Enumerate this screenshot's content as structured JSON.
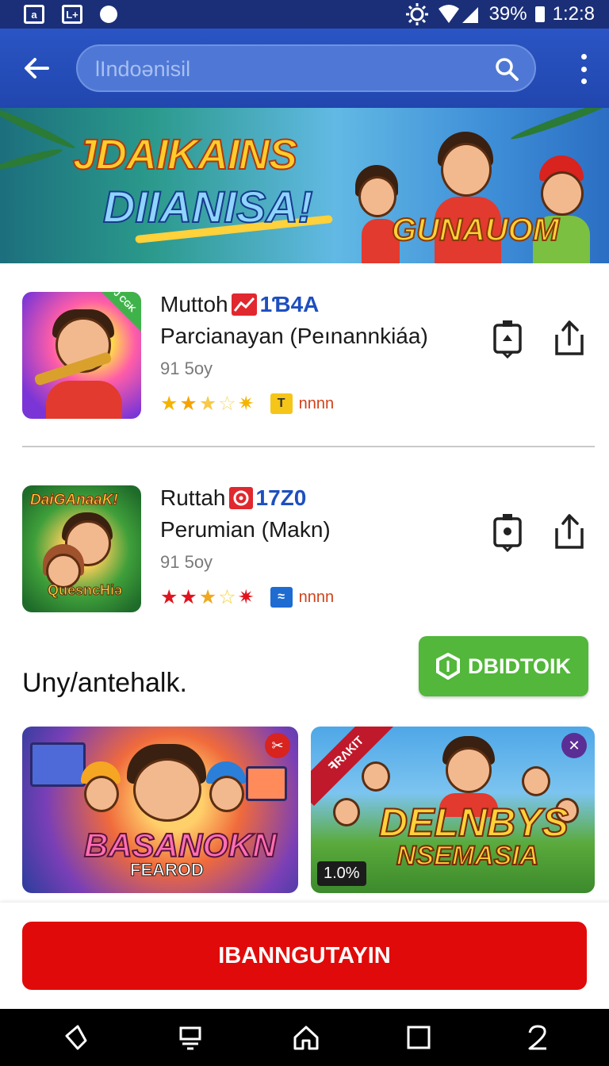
{
  "status_bar": {
    "icon_left_1": "a",
    "icon_left_2": "L+",
    "battery": "39%",
    "time": "1:2:8"
  },
  "app_bar": {
    "search_placeholder": "lIndoənisil"
  },
  "banner": {
    "title_line1": "JDAIKAINS",
    "title_line2": "DIIANISA!",
    "tag": "GUNAUOM"
  },
  "items": [
    {
      "title": "Muttoh",
      "code": "1Ɓ4A",
      "subtitle": "Parcianayan (Peınannkiáa)",
      "meta": "91 5oy",
      "count": "nnnn",
      "thumb_label": "J CGK",
      "flag_color": "#e0282e",
      "badge_color": "#f5c518"
    },
    {
      "title": "Ruttah",
      "code": "17Z0",
      "subtitle": "Perumian (Makn)",
      "meta": "91 5oy",
      "count": "nnnn",
      "thumb_label": "DaiGAnaaK!",
      "thumb_label2": "QuesncHiə",
      "flag_color": "#e0282e",
      "badge_color": "#1e6bd1"
    }
  ],
  "section": {
    "title": "Uny/antehalk.",
    "green_button": "DBIDTOIK"
  },
  "cards": [
    {
      "title": "BASANOKN",
      "subtitle": "FEAROD"
    },
    {
      "title": "DELNBYS",
      "subtitle": "NSEMASIA",
      "ribbon": "ꟻRɅKIT",
      "percent": "1.0%"
    }
  ],
  "primary_button": "IBANNGUTAYIN",
  "colors": {
    "appbar": "#2146ae",
    "primary_red": "#e10a0a",
    "green": "#52b73a",
    "link_blue": "#1e4fc0"
  },
  "icons": {
    "back": "arrow-left-icon",
    "search": "magnifier-icon",
    "menu": "more-vert-icon",
    "save": "bookmark-icon",
    "share": "share-icon",
    "nav_back": "nav-back-icon",
    "nav_recent": "nav-recent-icon",
    "nav_home": "home-icon",
    "nav_overview": "square-icon",
    "nav_other": "digit-icon"
  }
}
